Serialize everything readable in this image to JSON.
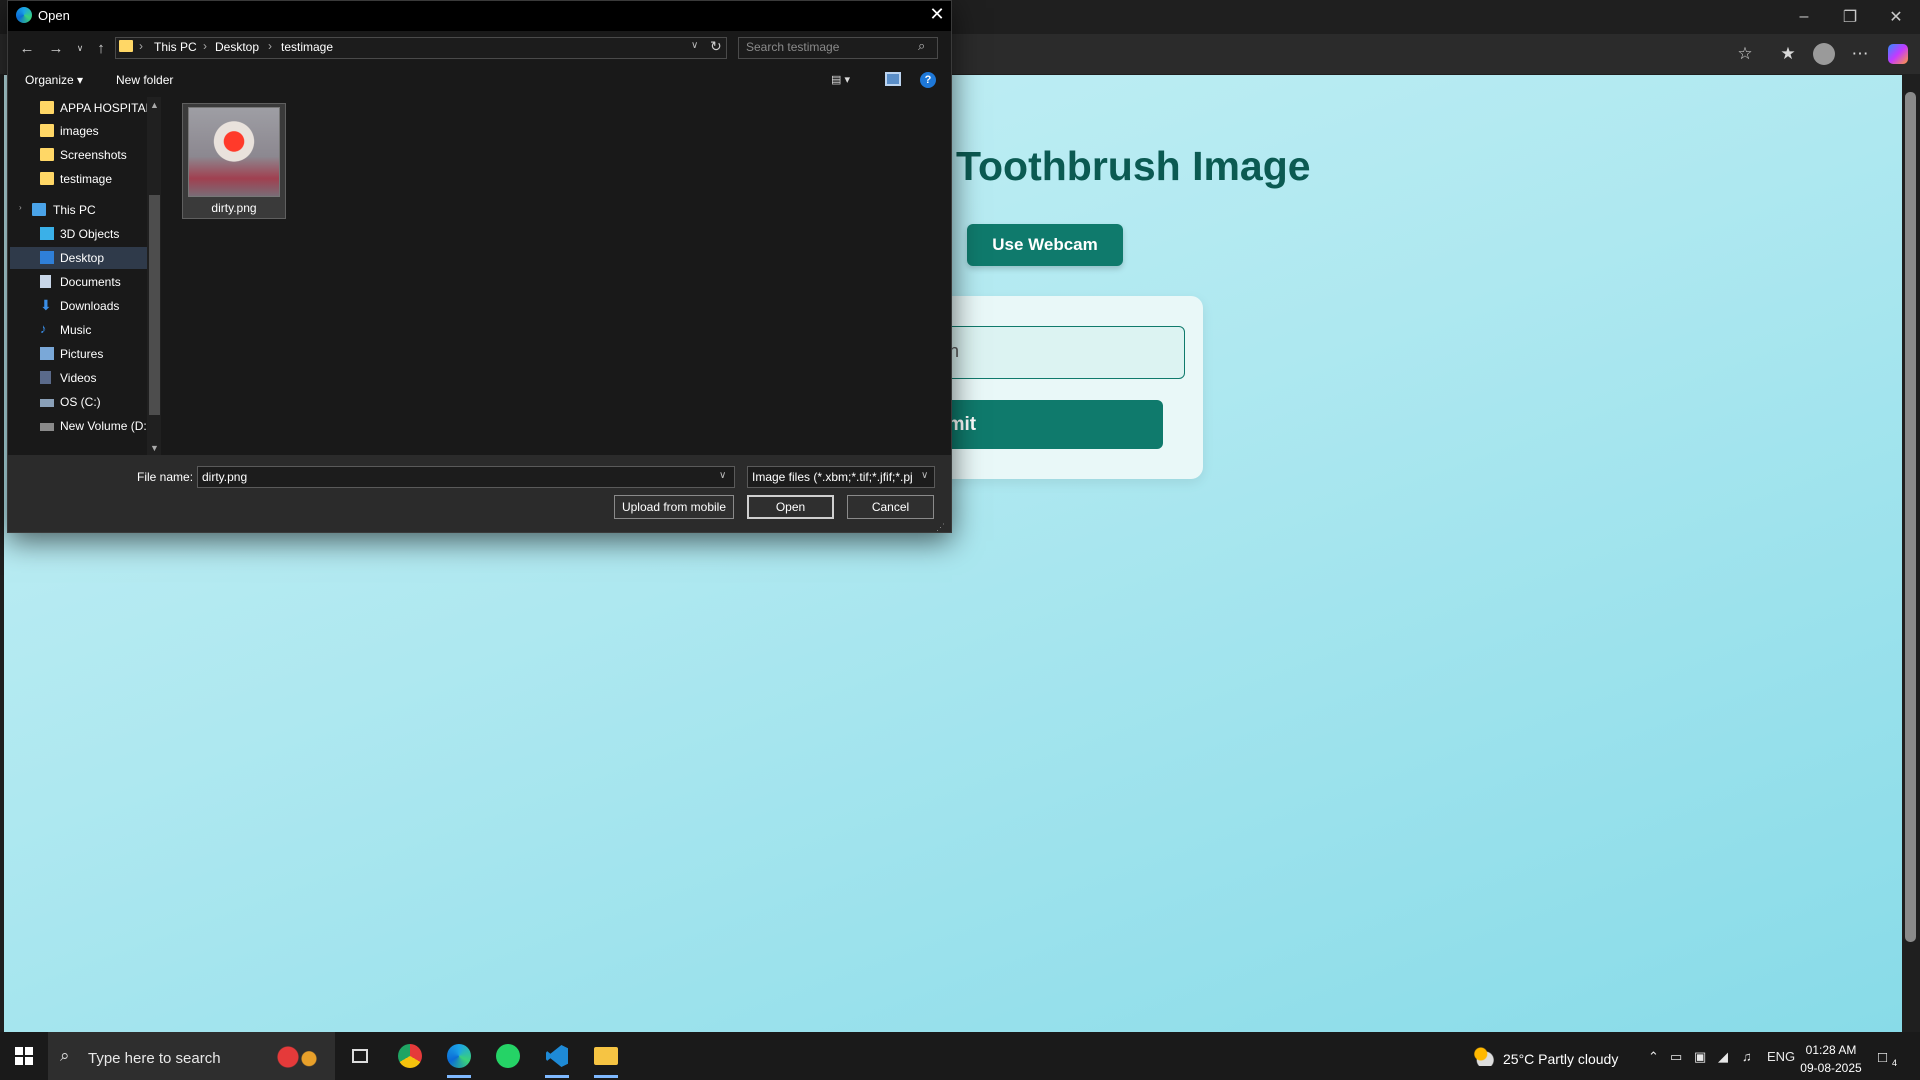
{
  "browser": {
    "page": {
      "heading": "Toothbrush Image",
      "webcam_button": "Use Webcam",
      "input_fragment": "n",
      "submit_fragment": "omit"
    }
  },
  "dialog": {
    "title": "Open",
    "breadcrumbs": [
      "This PC",
      "Desktop",
      "testimage"
    ],
    "search_placeholder": "Search testimage",
    "organize": "Organize",
    "new_folder": "New folder",
    "nav_items": [
      {
        "label": "APPA HOSPITAL",
        "icon": "folder-icon"
      },
      {
        "label": "images",
        "icon": "folder-icon"
      },
      {
        "label": "Screenshots",
        "icon": "folder-icon"
      },
      {
        "label": "testimage",
        "icon": "folder-icon"
      },
      {
        "label": "This PC",
        "icon": "pc-icon"
      },
      {
        "label": "3D Objects",
        "icon": "cube-icon"
      },
      {
        "label": "Desktop",
        "icon": "desktop-icon"
      },
      {
        "label": "Documents",
        "icon": "document-icon"
      },
      {
        "label": "Downloads",
        "icon": "download-icon"
      },
      {
        "label": "Music",
        "icon": "music-icon"
      },
      {
        "label": "Pictures",
        "icon": "pictures-icon"
      },
      {
        "label": "Videos",
        "icon": "video-icon"
      },
      {
        "label": "OS (C:)",
        "icon": "drive-icon"
      },
      {
        "label": "New Volume (D:",
        "icon": "drive-icon"
      }
    ],
    "files": [
      {
        "name": "dirty.png"
      }
    ],
    "file_name_label": "File name:",
    "file_name_value": "dirty.png",
    "file_type_value": "Image files (*.xbm;*.tif;*.jfif;*.pj",
    "upload_mobile": "Upload from mobile",
    "open": "Open",
    "cancel": "Cancel"
  },
  "taskbar": {
    "search_text": "Type here to search",
    "weather": "25°C  Partly cloudy",
    "language": "ENG",
    "time": "01:28 AM",
    "date": "09-08-2025",
    "notifications": "4"
  },
  "colors": {
    "accent": "#0f7a6c",
    "heading": "#0b5a52"
  }
}
